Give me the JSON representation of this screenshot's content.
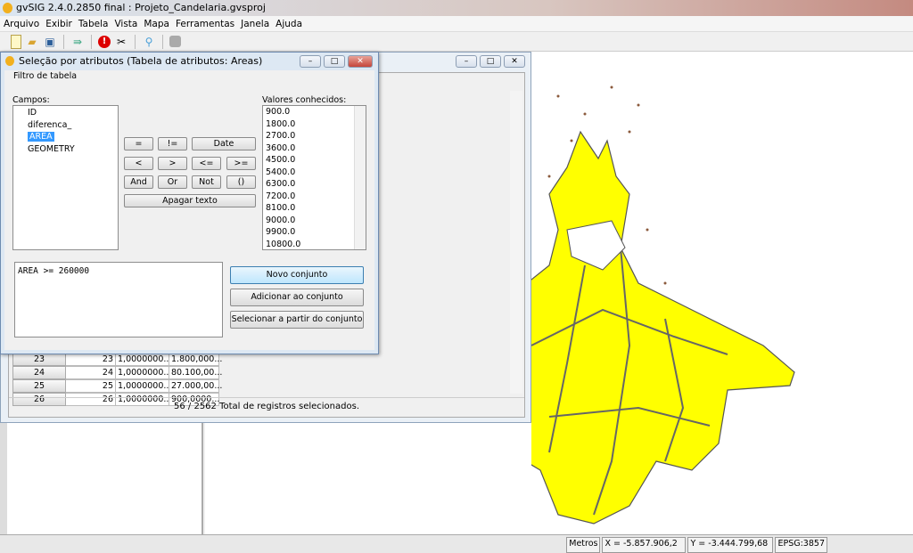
{
  "app": {
    "title": "gvSIG 2.4.0.2850 final : Projeto_Candelaria.gvsproj"
  },
  "menu": [
    "Arquivo",
    "Exibir",
    "Tabela",
    "Vista",
    "Mapa",
    "Ferramentas",
    "Janela",
    "Ajuda"
  ],
  "toolbar": [
    "new-icon",
    "open-icon",
    "save-icon",
    "layers-icon",
    "error-icon",
    "tools-icon",
    "locate-icon",
    "disabled-icon"
  ],
  "dialog": {
    "title": "Seleção por atributos (Tabela de atributos: Areas)",
    "group": "Filtro de tabela",
    "fields_label": "Campos:",
    "fields": [
      "ID",
      "diferenca_",
      "AREA",
      "GEOMETRY"
    ],
    "selected_field": "AREA",
    "values_label": "Valores conhecidos:",
    "values": [
      "900.0",
      "1800.0",
      "2700.0",
      "3600.0",
      "4500.0",
      "5400.0",
      "6300.0",
      "7200.0",
      "8100.0",
      "9000.0",
      "9900.0",
      "10800.0"
    ],
    "operators": [
      "=",
      "!=",
      "Date",
      "<",
      ">",
      "<=",
      ">=",
      "And",
      "Or",
      "Not",
      "()"
    ],
    "clear": "Apagar texto",
    "expression": "AREA >= 260000",
    "new_set": "Novo conjunto",
    "add_set": "Adicionar ao conjunto",
    "select_from_set": "Selecionar a partir do conjunto"
  },
  "table": {
    "rows": [
      [
        "23",
        "23",
        "1,0000000...",
        "1.800,000..."
      ],
      [
        "24",
        "24",
        "1,0000000...",
        "80.100,00..."
      ],
      [
        "25",
        "25",
        "1,0000000...",
        "27.000,00..."
      ],
      [
        "26",
        "26",
        "1,0000000...",
        "900,0000..."
      ]
    ],
    "status": "56 / 2562 Total de registros selecionados."
  },
  "statusbar": {
    "units": "Metros",
    "x": "X = -5.857.906,2",
    "y": "Y = -3.444.799,68",
    "epsg": "EPSG:3857"
  },
  "colors": {
    "polygon": "#ffff00",
    "outline": "#555555",
    "scatter": "#8b5a3c"
  }
}
